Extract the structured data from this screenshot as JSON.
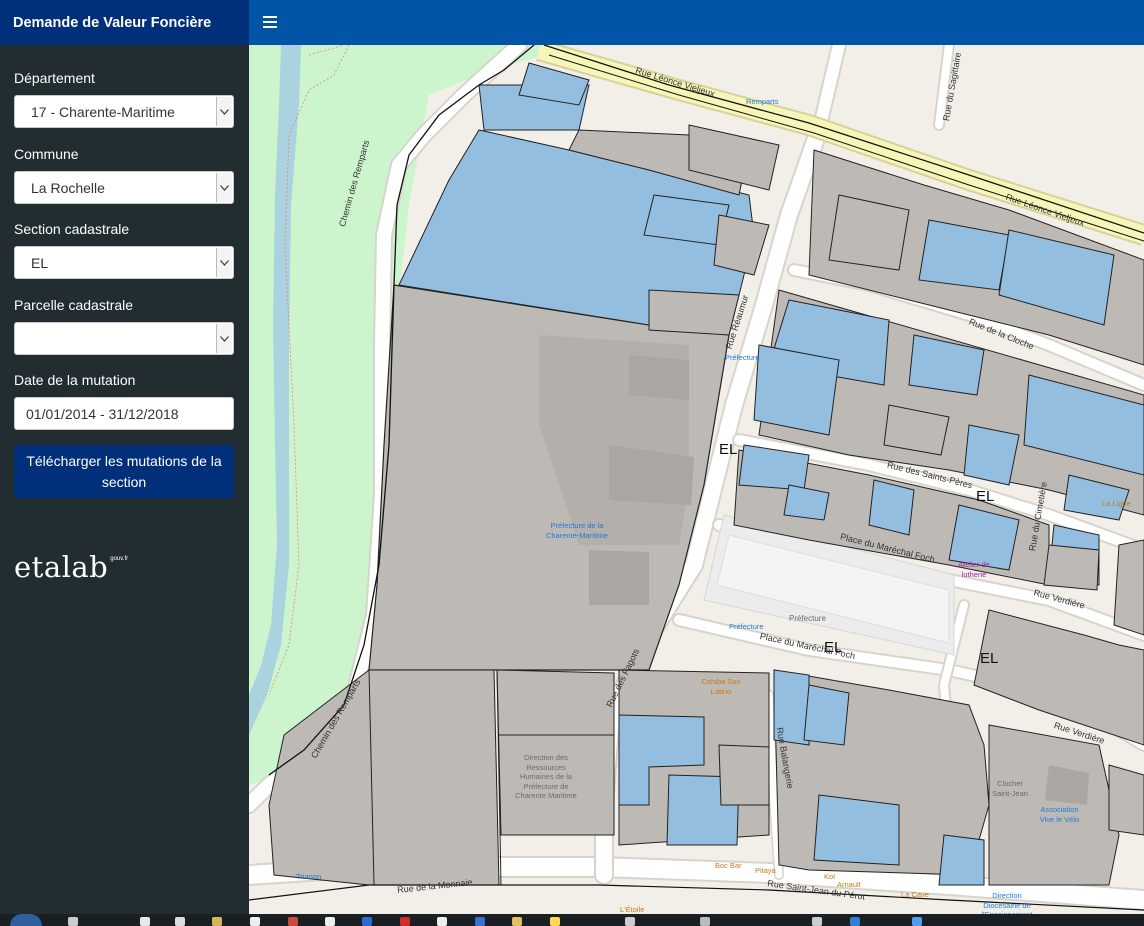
{
  "app": {
    "title": "Demande de Valeur Foncière",
    "menu_icon": "hamburger-icon"
  },
  "sidebar": {
    "departement": {
      "label": "Département",
      "value": "17 - Charente-Maritime"
    },
    "commune": {
      "label": "Commune",
      "value": "La Rochelle"
    },
    "section": {
      "label": "Section cadastrale",
      "value": "EL"
    },
    "parcelle": {
      "label": "Parcelle cadastrale",
      "value": ""
    },
    "date": {
      "label": "Date de la mutation",
      "value": "01/01/2014 - 31/12/2018"
    },
    "download_button": "Télécharger les mutations de la section",
    "logo_text": "etalab",
    "logo_suffix": "gouv.fr"
  },
  "map": {
    "section_codes": [
      "EL",
      "EL",
      "EL",
      "EL"
    ],
    "streets": {
      "leonce_1": "Rue Léonce Vieljeux",
      "leonce_2": "Rue Léonce Vieljeux",
      "remparts_1": "Chemin des Remparts",
      "remparts_2": "Chemin des Remparts",
      "reaumur": "Rue Réaumur",
      "cloche": "Rue de la Cloche",
      "saints_peres": "Rue des Saints-Pères",
      "foch_1": "Place du Maréchal Foch",
      "foch_2": "Place du Maréchal Foch",
      "verdiere_1": "Rue Verdière",
      "verdiere_2": "Rue Verdière",
      "fagots": "Rue des Fagots",
      "balangerie": "Rue Balangerie",
      "monnaie": "Rue de la Monnaie",
      "saint_jean": "Rue Saint-Jean du Pérot",
      "cimetiere": "Rue du Cimetière",
      "sagittaire": "Rue du Sagittaire"
    },
    "pois": {
      "remparts": "Remparts",
      "prefecture_bus": "Préfecture",
      "prefecture_building": "Préfecture de la Charente-Maritime",
      "prefecture_parking": "Préfecture",
      "prefecture_bike": "Préfecture",
      "atelier": "Atelier de lutherie",
      "cohiba": "Cohiba Son Latino",
      "direction": "Direction des Ressources Humaines de la Préfecture de Charente Maritime",
      "clocher": "Clocher Saint-Jean",
      "association": "Association Vive le Vélo",
      "trianon": "Trianon",
      "boc_bar": "Boc Bar",
      "pitaya": "Pitaya",
      "koi": "Koï",
      "arnault": "Arnault",
      "la_cave": "La Cave",
      "l_etoile": "L'Étoile",
      "diocesaine": "Direction Diocésaine de l'Enseignement",
      "la_ligne": "La Ligne"
    }
  },
  "colors": {
    "brand": "#022f79",
    "topbar": "#0255a6",
    "sidebar": "#222d32",
    "parcel_blue": "#94bedf",
    "parcel_gray": "#bdbab6",
    "park": "#cdf5cd",
    "water": "#aad3df"
  },
  "taskbar": {
    "icons": [
      "start-icon",
      "search-icon",
      "file-explorer-icon",
      "chrome-icon",
      "app-icon",
      "app-icon",
      "app-icon",
      "app-icon",
      "app-icon",
      "app-icon",
      "app-icon",
      "app-icon",
      "app-icon",
      "app-icon",
      "app-icon",
      "app-icon",
      "app-icon",
      "app-icon",
      "app-icon"
    ]
  }
}
